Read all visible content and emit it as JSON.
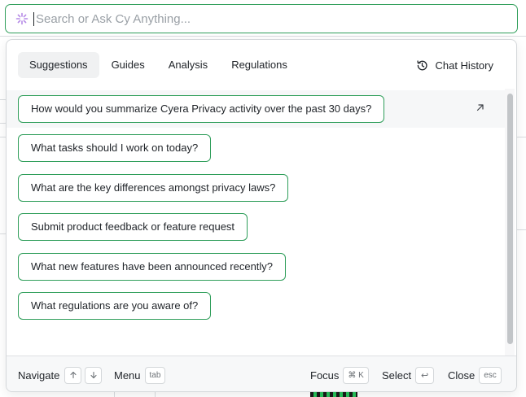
{
  "search": {
    "placeholder": "Search or Ask Cy Anything..."
  },
  "tabs": [
    {
      "label": "Suggestions"
    },
    {
      "label": "Guides"
    },
    {
      "label": "Analysis"
    },
    {
      "label": "Regulations"
    }
  ],
  "chat_history_label": "Chat History",
  "suggestions": [
    {
      "label": "How would you summarize Cyera Privacy activity over the past 30 days?"
    },
    {
      "label": "What tasks should I work on today?"
    },
    {
      "label": "What are the key differences amongst privacy laws?"
    },
    {
      "label": "Submit product feedback or feature request"
    },
    {
      "label": "What new features have been announced recently?"
    },
    {
      "label": "What regulations are you aware of?"
    }
  ],
  "footer": {
    "navigate_label": "Navigate",
    "menu_label": "Menu",
    "menu_key": "tab",
    "focus_label": "Focus",
    "focus_key": "⌘ K",
    "select_label": "Select",
    "select_key": "↩",
    "close_label": "Close",
    "close_key": "esc"
  },
  "colors": {
    "accent": "#2f9e5a",
    "sparkle": "#b58ae6"
  }
}
